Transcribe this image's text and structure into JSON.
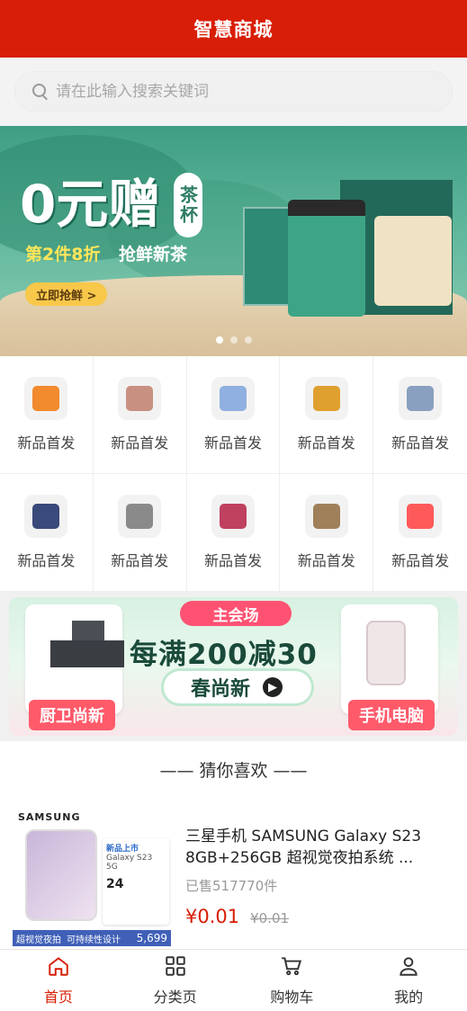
{
  "header": {
    "title": "智慧商城"
  },
  "search": {
    "placeholder": "请在此输入搜索关键词"
  },
  "banner": {
    "promo_main": "0元赠",
    "promo_badge": "茶杯",
    "promo_sub_yellow": "第2件8折",
    "promo_sub_white": "抢鲜新茶",
    "button_label": "立即抢鲜 >",
    "dots": [
      true,
      false,
      false
    ]
  },
  "categories": [
    {
      "label": "新品首发",
      "icon": "bag-icon"
    },
    {
      "label": "新品首发",
      "icon": "bedding-icon"
    },
    {
      "label": "新品首发",
      "icon": "shirt-icon"
    },
    {
      "label": "新品首发",
      "icon": "noodle-icon"
    },
    {
      "label": "新品首发",
      "icon": "tissue-icon"
    },
    {
      "label": "新品首发",
      "icon": "backpack-icon"
    },
    {
      "label": "新品首发",
      "icon": "luggage-icon"
    },
    {
      "label": "新品首发",
      "icon": "vacuum-icon"
    },
    {
      "label": "新品首发",
      "icon": "pet-food-icon"
    },
    {
      "label": "新品首发",
      "icon": "lightning-icon"
    }
  ],
  "promo": {
    "main_tag": "主会场",
    "headline": "每满200减30",
    "season_label": "春尚新",
    "left_tag": "厨卫尚新",
    "right_tag": "手机电脑"
  },
  "guess": {
    "title": "—— 猜你喜欢 ——"
  },
  "product": {
    "brand": "SAMSUNG",
    "spec_badge": "新品上市",
    "spec_model": "Galaxy S23 5G",
    "spec_rate": "24",
    "strip_left": "超视觉夜拍",
    "strip_mid": "可持续性设计",
    "strip_price": "5,699",
    "title": "三星手机 SAMSUNG Galaxy S23 8GB+256GB 超视觉夜拍系统 ...",
    "sold": "已售517770件",
    "price": "¥0.01",
    "old_price": "¥0.01"
  },
  "tabbar": [
    {
      "label": "首页",
      "icon": "home-icon",
      "active": true
    },
    {
      "label": "分类页",
      "icon": "grid-icon",
      "active": false
    },
    {
      "label": "购物车",
      "icon": "cart-icon",
      "active": false
    },
    {
      "label": "我的",
      "icon": "user-icon",
      "active": false
    }
  ],
  "colors": {
    "brand_red": "#d81e06",
    "promo_pink": "#ff5a6a"
  }
}
